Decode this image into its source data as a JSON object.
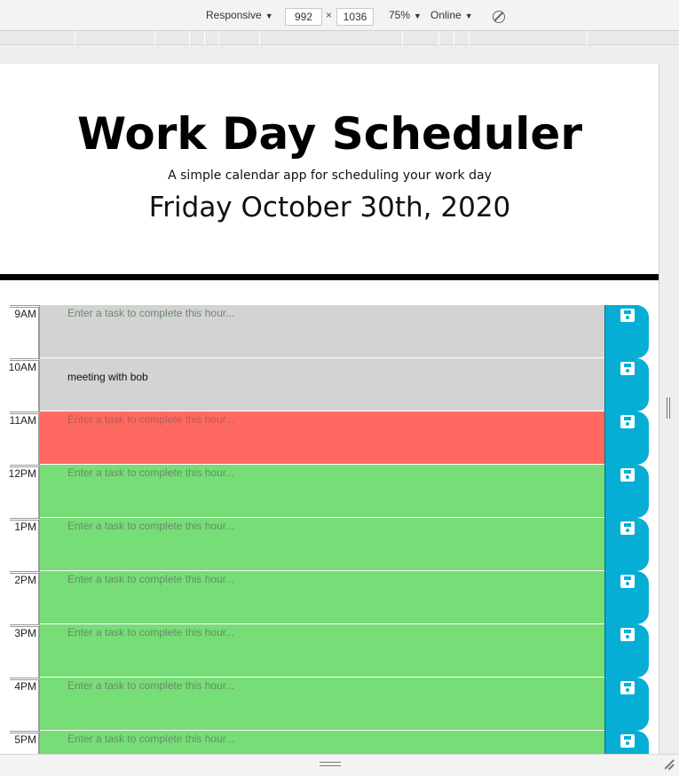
{
  "devtools": {
    "device": "Responsive",
    "width": "992",
    "separator": "×",
    "height": "1036",
    "zoom": "75%",
    "network": "Online",
    "rotate_icon": "rotate-disabled-icon"
  },
  "header": {
    "title": "Work Day Scheduler",
    "lead": "A simple calendar app for scheduling your work day",
    "current_day": "Friday October 30th, 2020"
  },
  "schedule": {
    "placeholder": "Enter a task to complete this hour...",
    "save_icon": "floppy-disk-icon",
    "colors": {
      "past": "#d3d3d3",
      "present": "#ff6961",
      "future": "#77dd77",
      "save": "#06aed5"
    },
    "rows": [
      {
        "hour": "9AM",
        "state": "past",
        "text": ""
      },
      {
        "hour": "10AM",
        "state": "past",
        "text": "meeting with bob"
      },
      {
        "hour": "11AM",
        "state": "present",
        "text": ""
      },
      {
        "hour": "12PM",
        "state": "future",
        "text": ""
      },
      {
        "hour": "1PM",
        "state": "future",
        "text": ""
      },
      {
        "hour": "2PM",
        "state": "future",
        "text": ""
      },
      {
        "hour": "3PM",
        "state": "future",
        "text": ""
      },
      {
        "hour": "4PM",
        "state": "future",
        "text": ""
      },
      {
        "hour": "5PM",
        "state": "future",
        "text": ""
      }
    ]
  }
}
